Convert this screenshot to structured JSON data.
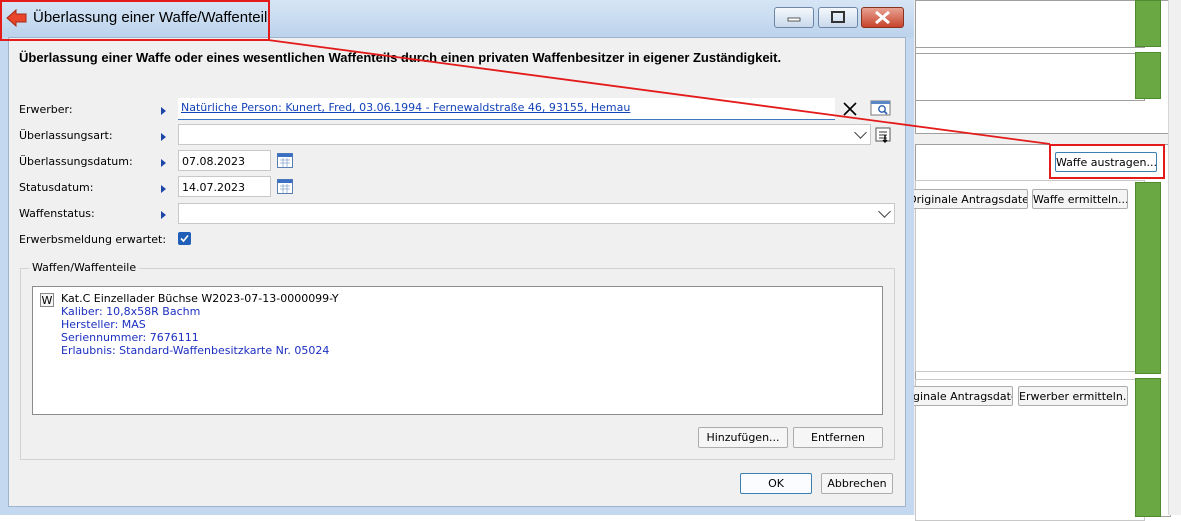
{
  "window": {
    "title": "Überlassung einer Waffe/Waffenteil",
    "headline": "Überlassung einer Waffe oder eines wesentlichen Waffenteils durch einen privaten Waffenbesitzer in eigener Zuständigkeit."
  },
  "form": {
    "erwerber_label": "Erwerber:",
    "erwerber_value": "Natürliche Person: Kunert, Fred, 03.06.1994 - Fernewaldstraße 46, 93155, Hemau",
    "ueberlassungsart_label": "Überlassungsart:",
    "ueberlassungsart_value": "",
    "ueberlassungsdatum_label": "Überlassungsdatum:",
    "ueberlassungsdatum_value": "07.08.2023",
    "statusdatum_label": "Statusdatum:",
    "statusdatum_value": "14.07.2023",
    "waffenstatus_label": "Waffenstatus:",
    "waffenstatus_value": "",
    "erwerbsmeldung_label": "Erwerbsmeldung erwartet:",
    "erwerbsmeldung_checked": true
  },
  "waffen": {
    "group_title": "Waffen/Waffenteile",
    "item_icon": "W",
    "item_title": "Kat.C Einzellader Büchse W2023-07-13-0000099-Y",
    "item_details": [
      "Kaliber: 10,8x58R Bachm",
      "Hersteller: MAS",
      "Seriennummer: 7676111",
      "Erlaubnis: Standard-Waffenbesitzkarte Nr. 05024"
    ],
    "add_label": "Hinzufügen...",
    "remove_label": "Entfernen"
  },
  "buttons": {
    "ok": "OK",
    "cancel": "Abbrechen"
  },
  "background": {
    "waffe_austragen": "Waffe austragen...",
    "originale_antragsdaten_1": "Originale Antragsdaten",
    "waffe_ermitteln": "Waffe ermitteln...",
    "originale_antragsdaten_2": "iginale Antragsdaten",
    "erwerber_ermitteln": "Erwerber ermitteln..."
  },
  "colors": {
    "annotation": "#e31b1b",
    "status_green": "#6aa843",
    "link_blue": "#1442b8"
  }
}
